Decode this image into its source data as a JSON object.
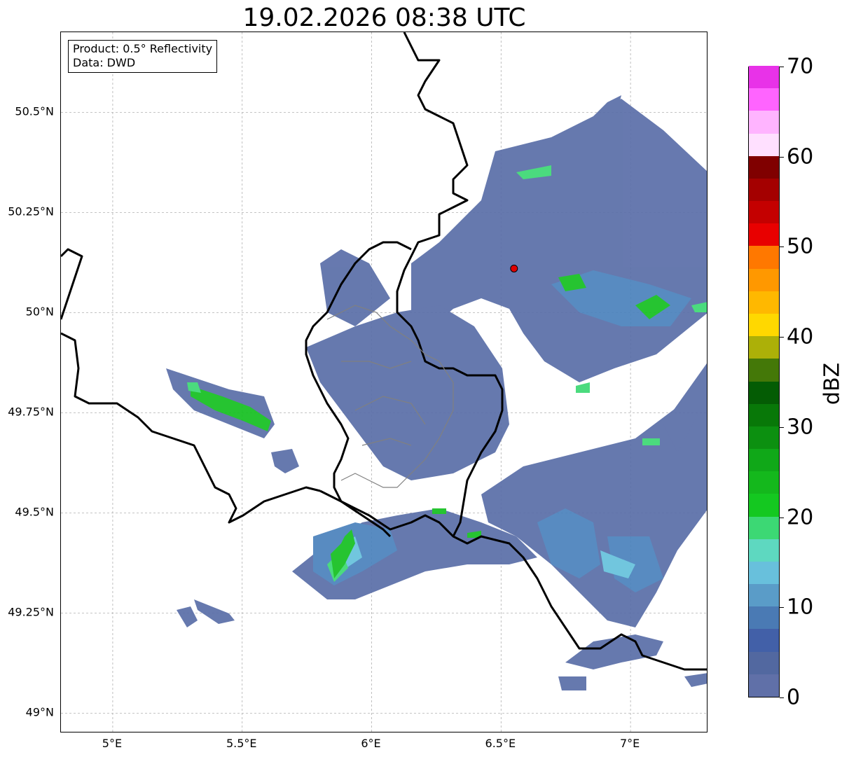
{
  "title": "19.02.2026 08:38 UTC",
  "info_box": {
    "product": "Product: 0.5° Reflectivity",
    "data": "Data: DWD"
  },
  "map": {
    "lon_range": [
      4.8,
      7.3
    ],
    "lat_range": [
      48.95,
      50.7
    ],
    "lat_ticks": [
      {
        "value": 50.5,
        "label": "50.5°N"
      },
      {
        "value": 50.25,
        "label": "50.25°N"
      },
      {
        "value": 50.0,
        "label": "50°N"
      },
      {
        "value": 49.75,
        "label": "49.75°N"
      },
      {
        "value": 49.5,
        "label": "49.5°N"
      },
      {
        "value": 49.25,
        "label": "49.25°N"
      },
      {
        "value": 49.0,
        "label": "49°N"
      }
    ],
    "lon_ticks": [
      {
        "value": 5.0,
        "label": "5°E"
      },
      {
        "value": 5.5,
        "label": "5.5°E"
      },
      {
        "value": 6.0,
        "label": "6°E"
      },
      {
        "value": 6.5,
        "label": "6.5°E"
      },
      {
        "value": 7.0,
        "label": "7°E"
      }
    ],
    "radar_site": {
      "lon": 6.55,
      "lat": 50.11,
      "color": "#e00000"
    }
  },
  "colorbar": {
    "label": "dBZ",
    "min": 0,
    "max": 70,
    "tick_values": [
      0,
      10,
      20,
      30,
      40,
      50,
      60,
      70
    ],
    "colors": [
      "#6070a8",
      "#5268a0",
      "#4260a8",
      "#4a7ab4",
      "#5a9cc8",
      "#68c0dc",
      "#5ed8c0",
      "#3cd874",
      "#14c820",
      "#14b81c",
      "#10a818",
      "#0c9010",
      "#087808",
      "#045c04",
      "#447808",
      "#acb008",
      "#ffd800",
      "#ffb800",
      "#ff9800",
      "#ff7800",
      "#e80000",
      "#c40000",
      "#a40000",
      "#800000",
      "#ffe0ff",
      "#ffb4ff",
      "#ff64ff",
      "#e832e8"
    ]
  }
}
